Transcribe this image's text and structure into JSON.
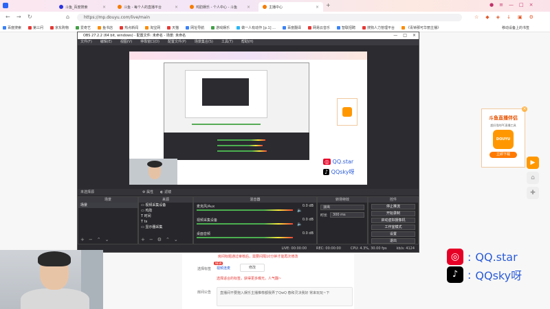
{
  "browser": {
    "tabs": [
      {
        "label": "斗鱼_百度搜索"
      },
      {
        "label": "斗鱼 - 每个人的直播平台"
      },
      {
        "label": "鸡肋娱乐 - 个人中心 - 斗鱼"
      },
      {
        "label": "主播中心"
      }
    ],
    "url": "https://mp.douyu.com/live/main",
    "bookmarks": [
      "百度搜索",
      "第三问",
      "京东购物",
      "爱奇艺",
      "鱼书店",
      "热点新闻",
      "淘宝网",
      "天猫",
      "网址导航",
      "游戏娱乐",
      "做一人有动作 [p.1] ...",
      "百度翻译",
      "网易云音乐",
      "智联招聘",
      "搜狗人力管理平台",
      "《青钟那可华丽主播》"
    ],
    "other_bookmarks": "移动设备上的书签"
  },
  "obs": {
    "title": "OBS 27.2.2 (64 bit, windows) - 配置文件: 未命名 - 场景: 未命名",
    "menu": [
      "文件(F)",
      "编辑(E)",
      "视图(V)",
      "停靠窗口(D)",
      "配置文件(P)",
      "场景集合(S)",
      "工具(T)",
      "帮助(H)"
    ],
    "preview_label": "未选择源",
    "properties_btn": "属性",
    "filters_btn": "滤镜",
    "docks": {
      "scenes": "场景",
      "sources": "来源",
      "mixer": "混音器",
      "transitions": "转场特效",
      "controls": "控件"
    },
    "scene_items": [
      "场景"
    ],
    "source_items": [
      "视频采集设备",
      "鸡肋",
      "时间",
      "ts",
      "显示器采集"
    ],
    "mixer_items": [
      {
        "name": "麦克风/Aux",
        "level": "0.0 dB"
      },
      {
        "name": "视频采集设备",
        "level": "0.0 dB"
      },
      {
        "name": "桌面音频",
        "level": "0.0 dB"
      }
    ],
    "transition": {
      "type": "淡出",
      "duration_label": "时长",
      "duration": "300 ms"
    },
    "controls": [
      "停止推流",
      "开始录制",
      "启动虚拟摄像机",
      "工作室模式",
      "设置",
      "退出"
    ],
    "status": {
      "live": "LIVE: 00:00:00",
      "rec": "REC: 00:00:00",
      "cpu": "CPU: 4.3%, 30.00 fps",
      "kbps": "kb/s: 4124"
    }
  },
  "page": {
    "notice": "房间标题通过审核后，需要间隔10分钟才能再次修改",
    "title_label": "选择标签",
    "new_badge": "NEW",
    "tag_value": "视频连麦",
    "modify_btn": "修改",
    "hint": "选择适合的标签，获得更多曝光，人气翻~",
    "announce_label": "房间公告",
    "announce_text": "直播间不要抱入娱乐主播推荐都我弄了QwQ 春和灵决我好 常来玩玩~下"
  },
  "ad": {
    "title": "斗鱼直播伴侣",
    "subtitle": "超好用的PC直播工具",
    "logo": "DOUYU",
    "button": "立即下载"
  },
  "overlay": {
    "netease_handle": "QQ.star",
    "tiktok_handle": "QQsky呀",
    "colon": ":"
  },
  "colors": {
    "accent": "#f57c00",
    "brand_blue": "#2a5bd7",
    "obs_bg": "#2b2b30"
  }
}
